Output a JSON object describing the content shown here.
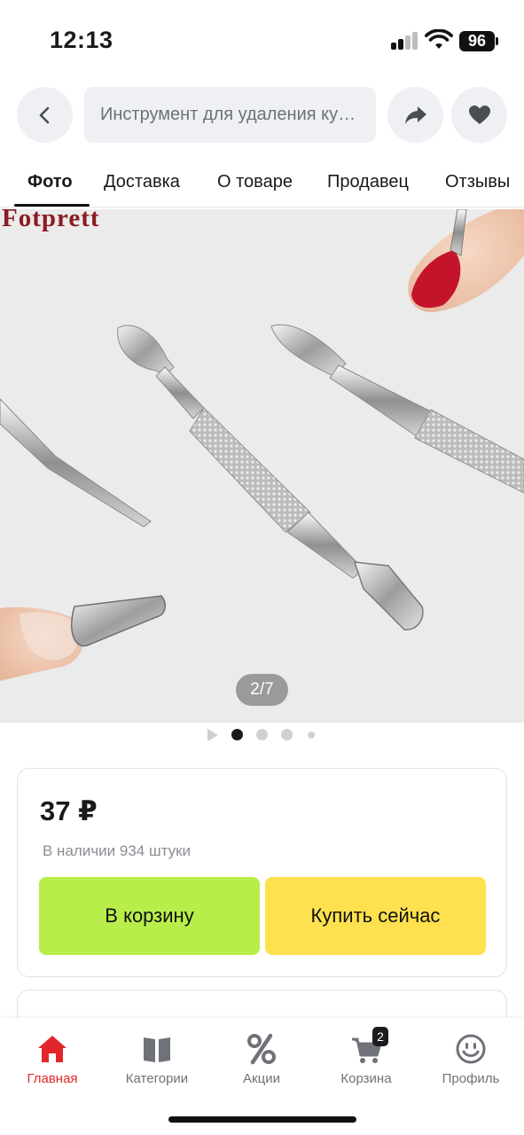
{
  "status_bar": {
    "time": "12:13",
    "battery": "96"
  },
  "top_nav": {
    "search_value": "Инструмент для удаления кутикулы",
    "icons": [
      "chevron-left-icon",
      "share-arrow-icon",
      "heart-icon"
    ]
  },
  "tabs": [
    {
      "label": "Фото",
      "active": true
    },
    {
      "label": "Доставка",
      "active": false
    },
    {
      "label": "О товаре",
      "active": false
    },
    {
      "label": "Продавец",
      "active": false
    },
    {
      "label": "Отзывы",
      "active": false
    }
  ],
  "gallery": {
    "brand_mark": "Fotprett",
    "photo_counter": "2/7",
    "current_index": 2,
    "total": 7,
    "selected_dot": 1
  },
  "product": {
    "price": "37 ₽",
    "stock": "В наличии 934 штуки",
    "add_to_cart_label": "В корзину",
    "buy_now_label": "Купить сейчас",
    "colors": {
      "cart_button": "#b8ee4a",
      "buy_button": "#ffe04f"
    }
  },
  "bottom_nav": {
    "items": [
      {
        "label": "Главная",
        "icon": "home-icon",
        "active": true
      },
      {
        "label": "Категории",
        "icon": "book-icon",
        "active": false
      },
      {
        "label": "Акции",
        "icon": "percent-icon",
        "active": false
      },
      {
        "label": "Корзина",
        "icon": "cart-icon",
        "active": false,
        "badge": "2"
      },
      {
        "label": "Профиль",
        "icon": "smiley-icon",
        "active": false
      }
    ],
    "accent_color": "#e2262b"
  }
}
